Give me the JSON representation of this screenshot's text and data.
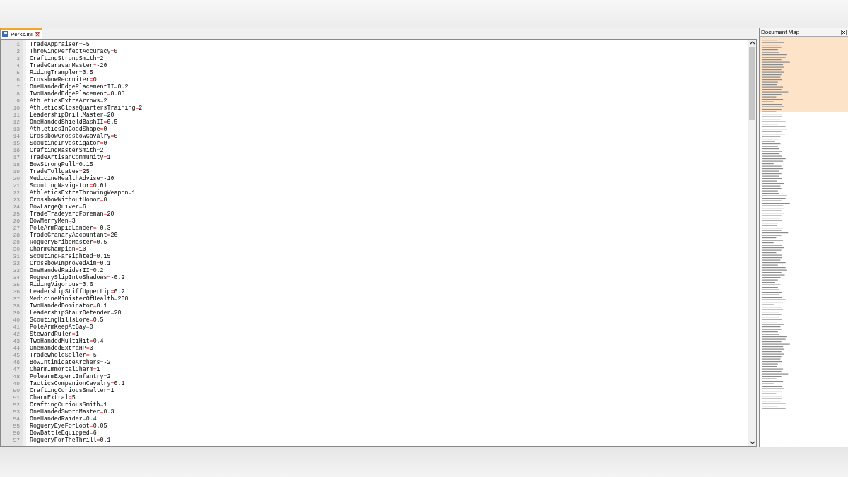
{
  "tab": {
    "label": "Perks.ini",
    "selected": true
  },
  "document_map": {
    "title": "Document Map"
  },
  "lines": [
    {
      "number": "1",
      "name": "TradeAppraiser",
      "operator": "=",
      "value": "-5"
    },
    {
      "number": "2",
      "name": "ThrowingPerfectAccuracy",
      "operator": "=",
      "value": "0"
    },
    {
      "number": "3",
      "name": "CraftingStrongSmith",
      "operator": "=",
      "value": "2"
    },
    {
      "number": "4",
      "name": "TradeCaravanMaster",
      "operator": "=",
      "value": "-20"
    },
    {
      "number": "5",
      "name": "RidingTrampler",
      "operator": "=",
      "value": "0.5"
    },
    {
      "number": "6",
      "name": "CrossbowRecruiter",
      "operator": "=",
      "value": "0"
    },
    {
      "number": "7",
      "name": "OneHandedEdgePlacementII",
      "operator": "=",
      "value": "0.2"
    },
    {
      "number": "8",
      "name": "TwoHandedEdgePlacement",
      "operator": "=",
      "value": "0.03"
    },
    {
      "number": "9",
      "name": "AthleticsExtraArrows",
      "operator": "=",
      "value": "2"
    },
    {
      "number": "10",
      "name": "AthleticsCloseQuartersTraining",
      "operator": "=",
      "value": "2"
    },
    {
      "number": "11",
      "name": "LeadershipDrillMaster",
      "operator": "=",
      "value": "20"
    },
    {
      "number": "12",
      "name": "OneHandedShieldBashII",
      "operator": "=",
      "value": "0.5"
    },
    {
      "number": "13",
      "name": "AthleticsInGoodShape",
      "operator": "=",
      "value": "0"
    },
    {
      "number": "14",
      "name": "CrossbowCrossbowCavalry",
      "operator": "=",
      "value": "0"
    },
    {
      "number": "15",
      "name": "ScoutingInvestigator",
      "operator": "=",
      "value": "0"
    },
    {
      "number": "16",
      "name": "CraftingMasterSmith",
      "operator": "=",
      "value": "2"
    },
    {
      "number": "17",
      "name": "TradeArtisanCommunity",
      "operator": "=",
      "value": "1"
    },
    {
      "number": "18",
      "name": "BowStrongPull",
      "operator": "=",
      "value": "0.15"
    },
    {
      "number": "19",
      "name": "TradeTollgates",
      "operator": "=",
      "value": "25"
    },
    {
      "number": "20",
      "name": "MedicineHealthAdvise",
      "operator": "=",
      "value": "-10"
    },
    {
      "number": "21",
      "name": "ScoutingNavigator",
      "operator": "=",
      "value": "0.01"
    },
    {
      "number": "22",
      "name": "AthleticsExtraThrowingWeapon",
      "operator": "=",
      "value": "1"
    },
    {
      "number": "23",
      "name": "CrossbowWithoutHonor",
      "operator": "=",
      "value": "0"
    },
    {
      "number": "24",
      "name": "BowLargeQuiver",
      "operator": "=",
      "value": "6"
    },
    {
      "number": "25",
      "name": "TradeTradeyardForeman",
      "operator": "=",
      "value": "20"
    },
    {
      "number": "26",
      "name": "BowMerryMen",
      "operator": "=",
      "value": "3"
    },
    {
      "number": "27",
      "name": "PoleArmRapidLancer",
      "operator": "=",
      "value": "-0.3"
    },
    {
      "number": "28",
      "name": "TradeGranaryAccountant",
      "operator": "=",
      "value": "20"
    },
    {
      "number": "29",
      "name": "RogueryBribeMaster",
      "operator": "=",
      "value": "0.5"
    },
    {
      "number": "30",
      "name": "CharmChampion",
      "operator": "=",
      "value": "10"
    },
    {
      "number": "31",
      "name": "ScoutingFarsighted",
      "operator": "=",
      "value": "0.15"
    },
    {
      "number": "32",
      "name": "CrossbowImprovedAim",
      "operator": "=",
      "value": "0.1"
    },
    {
      "number": "33",
      "name": "OneHandedRaiderII",
      "operator": "=",
      "value": "0.2"
    },
    {
      "number": "34",
      "name": "RoguerySlipIntoShadows",
      "operator": "=",
      "value": "-0.2"
    },
    {
      "number": "35",
      "name": "RidingVigorous",
      "operator": "=",
      "value": "0.6"
    },
    {
      "number": "36",
      "name": "LeadershipStiffUpperLip",
      "operator": "=",
      "value": "0.2"
    },
    {
      "number": "37",
      "name": "MedicineMinisterOfHealth",
      "operator": "=",
      "value": "200"
    },
    {
      "number": "38",
      "name": "TwoHandedDominator",
      "operator": "=",
      "value": "0.1"
    },
    {
      "number": "39",
      "name": "LeadershipStaurDefender",
      "operator": "=",
      "value": "20"
    },
    {
      "number": "40",
      "name": "ScoutingHillsLore",
      "operator": "=",
      "value": "0.5"
    },
    {
      "number": "41",
      "name": "PoleArmKeepAtBay",
      "operator": "=",
      "value": "0"
    },
    {
      "number": "42",
      "name": "StewardRuler",
      "operator": "=",
      "value": "1"
    },
    {
      "number": "43",
      "name": "TwoHandedMultiHit",
      "operator": "=",
      "value": "0.4"
    },
    {
      "number": "44",
      "name": "OneHandedExtraHP",
      "operator": "=",
      "value": "3"
    },
    {
      "number": "45",
      "name": "TradeWholeSeller",
      "operator": "=",
      "value": "-5"
    },
    {
      "number": "46",
      "name": "BowIntimidateArchers",
      "operator": "=",
      "value": "-2"
    },
    {
      "number": "47",
      "name": "CharmImmortalCharm",
      "operator": "=",
      "value": "1"
    },
    {
      "number": "48",
      "name": "PolearmExpertInfantry",
      "operator": "=",
      "value": "2"
    },
    {
      "number": "49",
      "name": "TacticsCompanionCavalry",
      "operator": "=",
      "value": "0.1"
    },
    {
      "number": "50",
      "name": "CraftingCuriousSmelter",
      "operator": "=",
      "value": "1"
    },
    {
      "number": "51",
      "name": "CharmExtral",
      "operator": "=",
      "value": "5"
    },
    {
      "number": "52",
      "name": "CraftingCuriousSmith",
      "operator": "=",
      "value": "1"
    },
    {
      "number": "53",
      "name": "OneHandedSwordMaster",
      "operator": "=",
      "value": "0.3"
    },
    {
      "number": "54",
      "name": "OneHandedRaider",
      "operator": "=",
      "value": "0.4"
    },
    {
      "number": "55",
      "name": "RogueryEyeForLoot",
      "operator": "=",
      "value": "0.05"
    },
    {
      "number": "56",
      "name": "BowBattleEquipped",
      "operator": "=",
      "value": "6"
    },
    {
      "number": "57",
      "name": "RogueryForTheThrill",
      "operator": "=",
      "value": "0.1"
    }
  ]
}
